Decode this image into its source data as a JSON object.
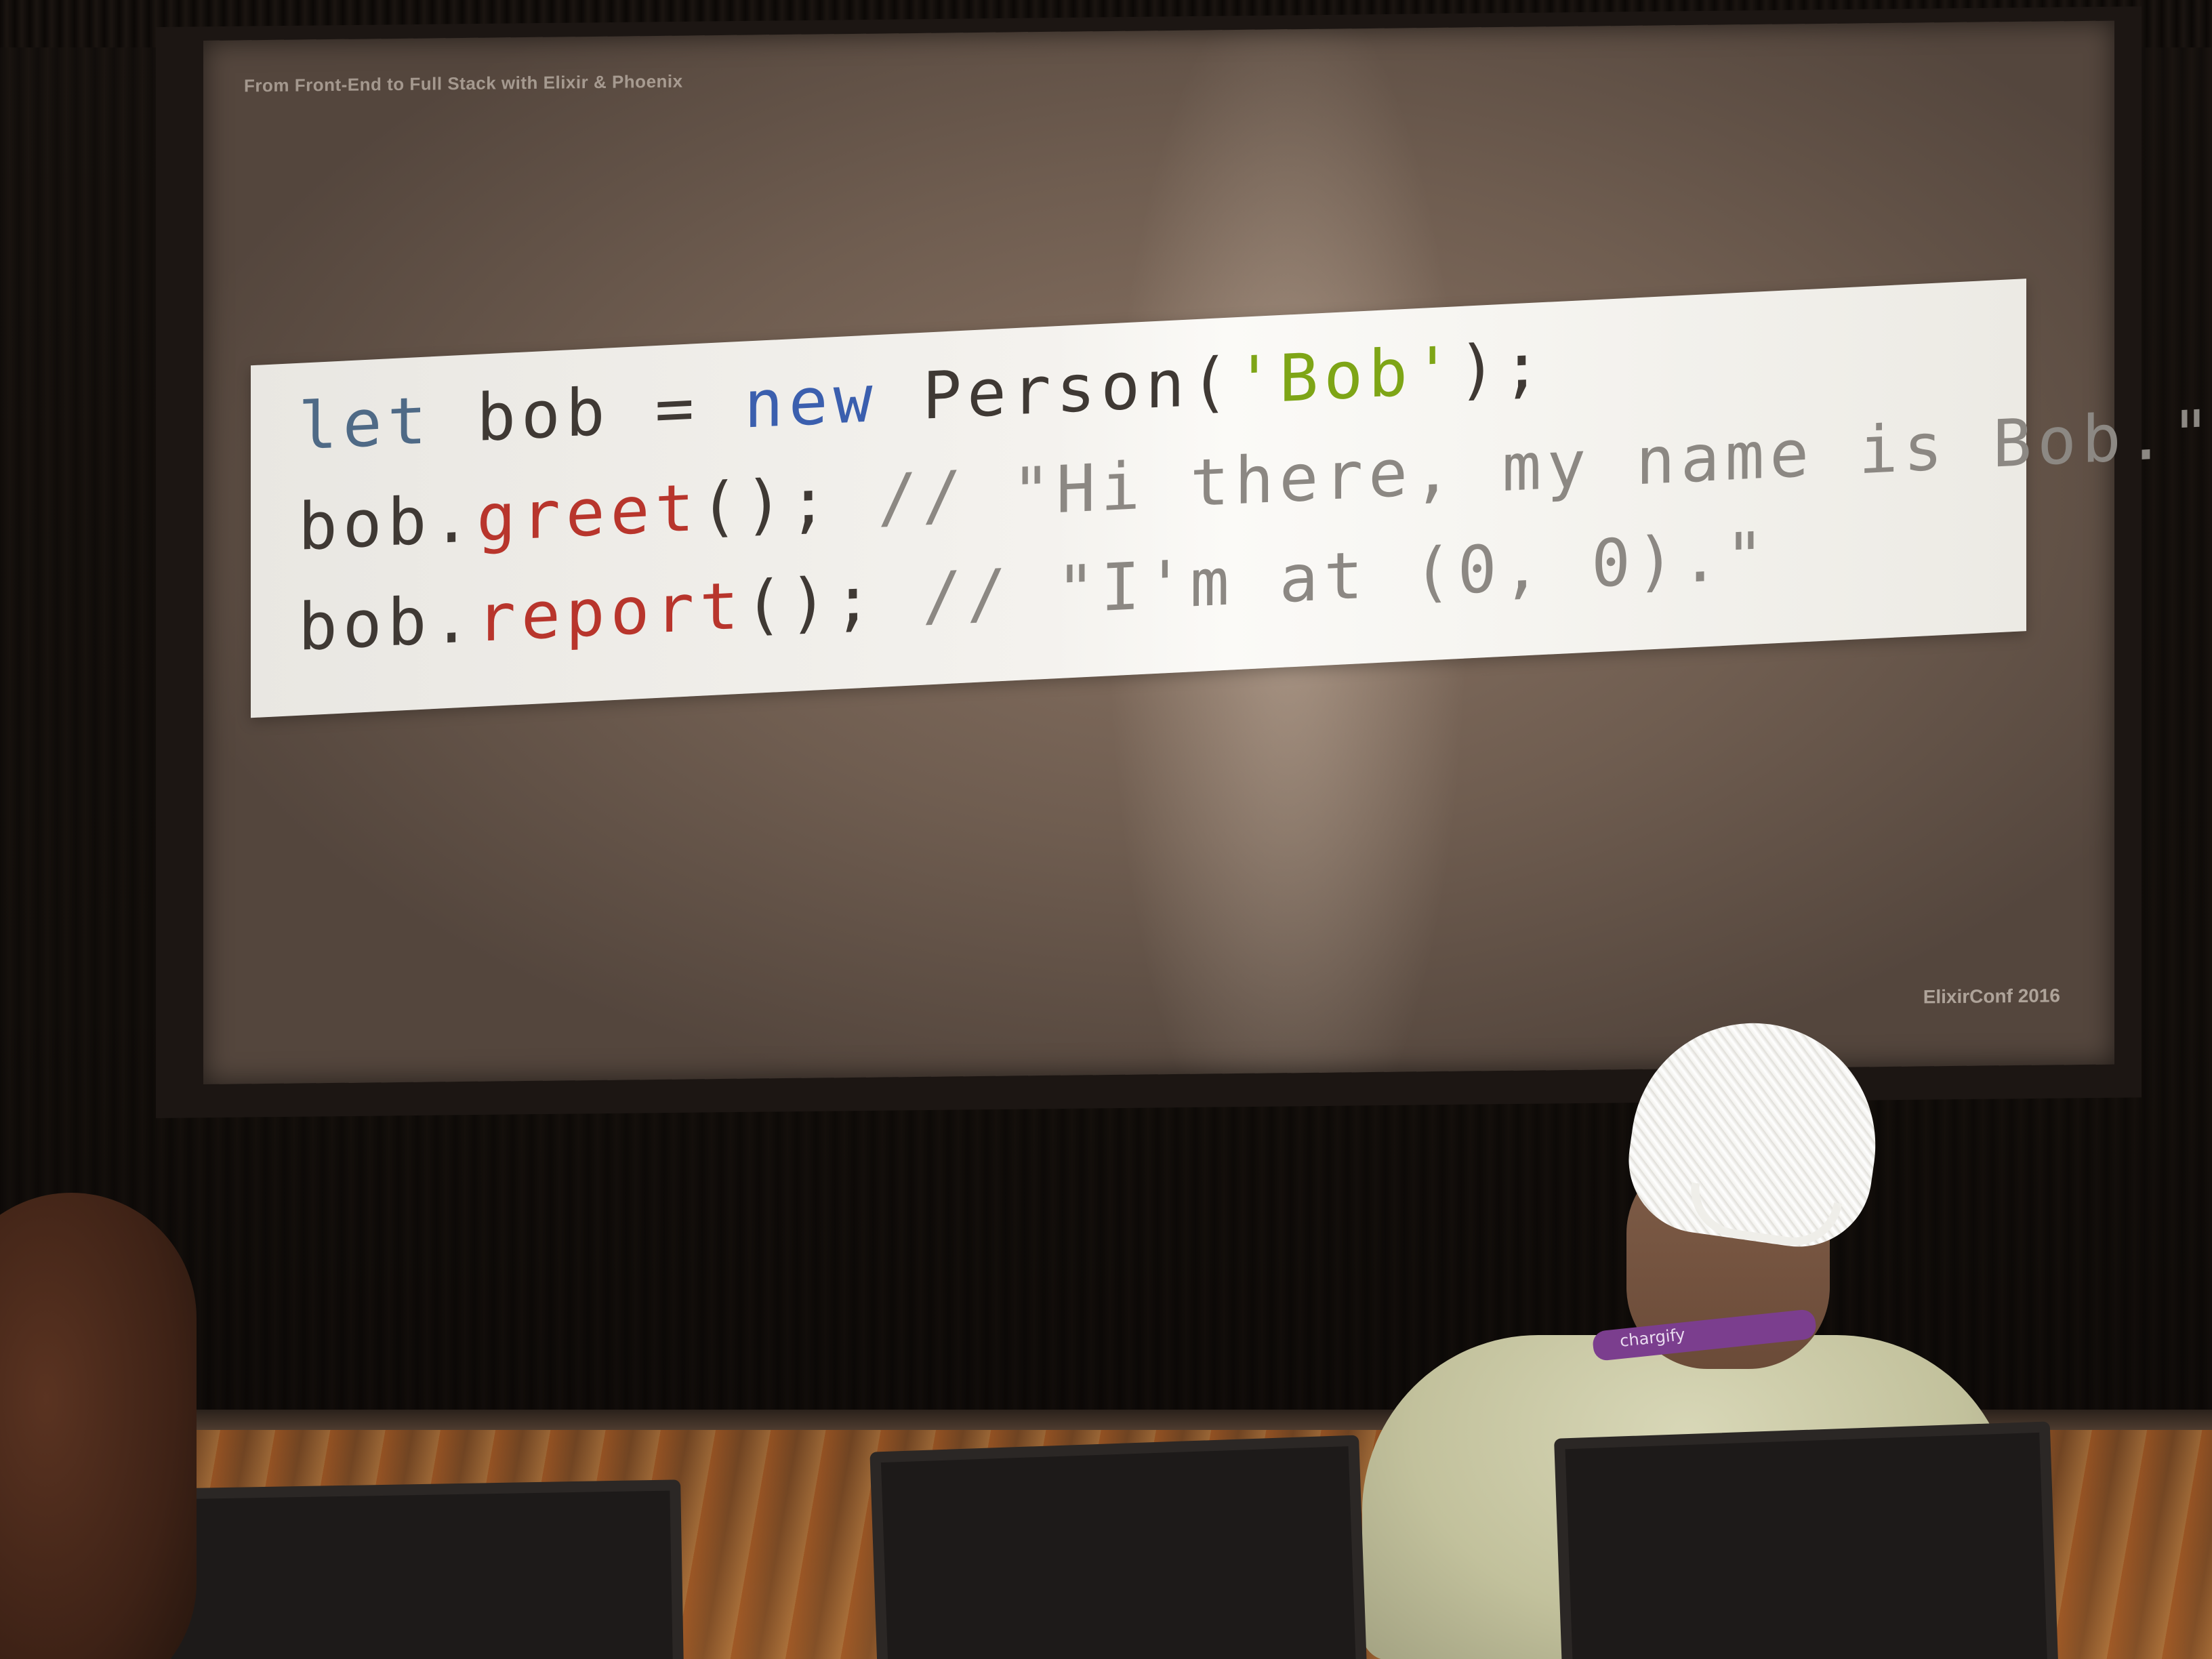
{
  "slide": {
    "header": "From Front-End to Full Stack with Elixir & Phoenix",
    "footer": "ElixirConf 2016",
    "code": {
      "line1": {
        "let": "let",
        "a": " bob = ",
        "new": "new",
        "b": " Person(",
        "str": "'Bob'",
        "c": ");"
      },
      "line2": {
        "a": "bob.",
        "fn": "greet",
        "b": "(); ",
        "comment": "// \"Hi there, my name is Bob.\""
      },
      "line3": {
        "a": "bob.",
        "fn": "report",
        "b": "(); ",
        "comment": "// \"I'm at (0, 0).\""
      }
    }
  },
  "badge": {
    "lanyard_text": "chargify"
  },
  "colors": {
    "keyword": "#3b5fae",
    "string": "#7ea516",
    "method": "#b8352c",
    "comment": "#8c8883"
  }
}
